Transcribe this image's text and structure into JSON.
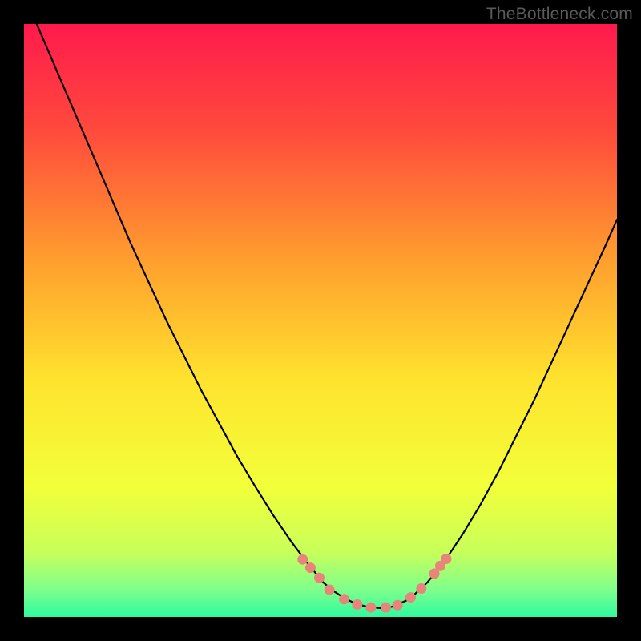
{
  "watermark": "TheBottleneck.com",
  "colors": {
    "frame": "#000000",
    "curve_stroke": "#000000",
    "marker_fill": "#e9847b",
    "gradient_stops": [
      {
        "offset": 0.0,
        "hex": "#ff1a4d"
      },
      {
        "offset": 0.18,
        "hex": "#ff4a3c"
      },
      {
        "offset": 0.4,
        "hex": "#ff9f2e"
      },
      {
        "offset": 0.6,
        "hex": "#ffe32e"
      },
      {
        "offset": 0.78,
        "hex": "#f2ff3a"
      },
      {
        "offset": 0.89,
        "hex": "#c8ff5a"
      },
      {
        "offset": 0.955,
        "hex": "#7dff8c"
      },
      {
        "offset": 1.0,
        "hex": "#2dfba0"
      }
    ]
  },
  "chart_data": {
    "type": "line",
    "title": "",
    "xlabel": "",
    "ylabel": "",
    "xlim": [
      0,
      1
    ],
    "ylim": [
      0,
      1
    ],
    "series": [
      {
        "name": "bottleneck-curve",
        "x": [
          0.0,
          0.03,
          0.06,
          0.09,
          0.12,
          0.15,
          0.18,
          0.21,
          0.24,
          0.27,
          0.3,
          0.33,
          0.36,
          0.39,
          0.42,
          0.45,
          0.48,
          0.505,
          0.52,
          0.54,
          0.56,
          0.58,
          0.6,
          0.62,
          0.65,
          0.68,
          0.71,
          0.74,
          0.77,
          0.8,
          0.83,
          0.86,
          0.89,
          0.92,
          0.95,
          0.98,
          1.0
        ],
        "y": [
          1.05,
          0.98,
          0.91,
          0.84,
          0.77,
          0.7,
          0.63,
          0.565,
          0.5,
          0.44,
          0.38,
          0.325,
          0.27,
          0.22,
          0.172,
          0.128,
          0.088,
          0.058,
          0.045,
          0.032,
          0.022,
          0.017,
          0.015,
          0.017,
          0.03,
          0.058,
          0.095,
          0.14,
          0.19,
          0.245,
          0.305,
          0.365,
          0.43,
          0.495,
          0.56,
          0.625,
          0.67
        ]
      }
    ],
    "markers": {
      "name": "highlight-dots",
      "points": [
        {
          "x": 0.47,
          "y": 0.097
        },
        {
          "x": 0.483,
          "y": 0.083
        },
        {
          "x": 0.498,
          "y": 0.066
        },
        {
          "x": 0.515,
          "y": 0.046
        },
        {
          "x": 0.54,
          "y": 0.03
        },
        {
          "x": 0.562,
          "y": 0.021
        },
        {
          "x": 0.585,
          "y": 0.016
        },
        {
          "x": 0.61,
          "y": 0.016
        },
        {
          "x": 0.63,
          "y": 0.02
        },
        {
          "x": 0.652,
          "y": 0.033
        },
        {
          "x": 0.67,
          "y": 0.048
        },
        {
          "x": 0.692,
          "y": 0.073
        },
        {
          "x": 0.702,
          "y": 0.086
        },
        {
          "x": 0.712,
          "y": 0.098
        }
      ]
    }
  }
}
